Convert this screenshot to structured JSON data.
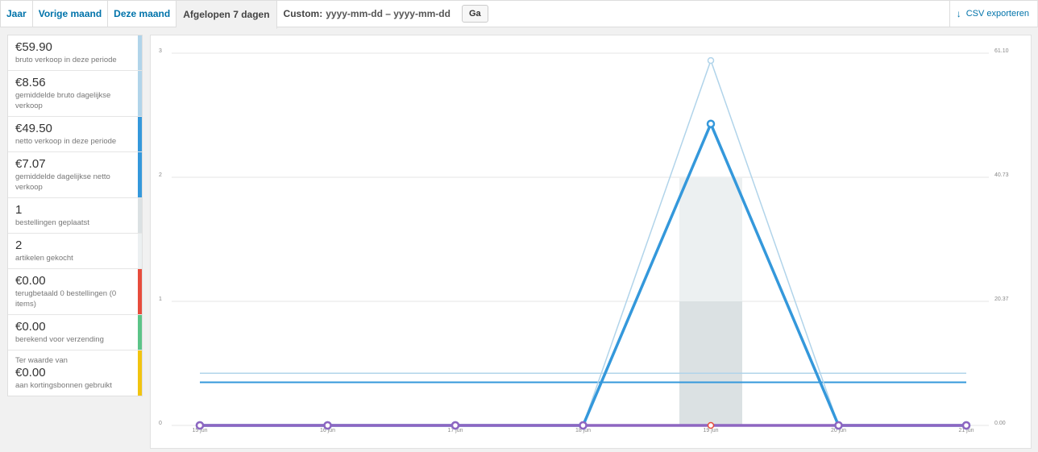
{
  "tabs": [
    {
      "label": "Jaar",
      "active": false
    },
    {
      "label": "Vorige maand",
      "active": false
    },
    {
      "label": "Deze maand",
      "active": false
    },
    {
      "label": "Afgelopen 7 dagen",
      "active": true
    }
  ],
  "custom": {
    "label": "Custom:",
    "range": "yyyy-mm-dd – yyyy-mm-dd",
    "go_label": "Ga"
  },
  "export": {
    "label": "CSV exporteren",
    "icon": "download-arrow-icon"
  },
  "legend": [
    {
      "amount": "€59.90",
      "desc": "bruto verkoop in deze periode",
      "color": "#b1d4ea"
    },
    {
      "amount": "€8.56",
      "desc": "gemiddelde bruto dagelijkse verkoop",
      "color": "#b1d4ea"
    },
    {
      "amount": "€49.50",
      "desc": "netto verkoop in deze periode",
      "color": "#3498db"
    },
    {
      "amount": "€7.07",
      "desc": "gemiddelde dagelijkse netto verkoop",
      "color": "#3498db"
    },
    {
      "amount": "1",
      "desc": "bestellingen geplaatst",
      "color": "#dbe1e3"
    },
    {
      "amount": "2",
      "desc": "artikelen gekocht",
      "color": "#ecf0f1"
    },
    {
      "amount": "€0.00",
      "desc": "terugbetaald 0 bestellingen (0 items)",
      "color": "#e74c3c"
    },
    {
      "amount": "€0.00",
      "desc": "berekend voor verzending",
      "color": "#5cc488"
    },
    {
      "prefix": "Ter waarde van",
      "amount": "€0.00",
      "desc": "aan kortingsbonnen gebruikt",
      "color": "#f1c40f"
    }
  ],
  "chart_data": {
    "type": "line",
    "categories": [
      "15 jun",
      "16 jun",
      "17 jun",
      "18 jun",
      "19 jun",
      "20 jun",
      "21 jun"
    ],
    "y_left": {
      "ticks": [
        "0",
        "1",
        "2",
        "3"
      ],
      "range": [
        0,
        3
      ]
    },
    "y_right": {
      "ticks": [
        "0.00",
        "20.37",
        "40.73",
        "61.10"
      ],
      "range": [
        0,
        61.1
      ]
    },
    "series": [
      {
        "key": "gross_sales",
        "axis": "right",
        "type": "line",
        "color": "#b1d4ea",
        "values": [
          0,
          0,
          0,
          0,
          59.9,
          0,
          0
        ]
      },
      {
        "key": "net_sales",
        "axis": "right",
        "type": "line",
        "color": "#3498db",
        "values": [
          0,
          0,
          0,
          0,
          49.5,
          0,
          0
        ]
      },
      {
        "key": "avg_gross",
        "axis": "right",
        "type": "hline",
        "color": "#b1d4ea",
        "value": 8.56
      },
      {
        "key": "avg_net",
        "axis": "right",
        "type": "hline",
        "color": "#3498db",
        "value": 7.07
      },
      {
        "key": "items_bought",
        "axis": "left",
        "type": "bar",
        "color": "#ecf0f1",
        "values": [
          0,
          0,
          0,
          0,
          2,
          0,
          0
        ]
      },
      {
        "key": "orders_placed",
        "axis": "left",
        "type": "bar",
        "color": "#dbe1e3",
        "values": [
          0,
          0,
          0,
          0,
          1,
          0,
          0
        ]
      },
      {
        "key": "refunds",
        "axis": "right",
        "type": "line",
        "color": "#e74c3c",
        "values": [
          0,
          0,
          0,
          0,
          0,
          0,
          0
        ]
      },
      {
        "key": "shipping",
        "axis": "right",
        "type": "line",
        "color": "#5cc488",
        "values": [
          0,
          0,
          0,
          0,
          0,
          0,
          0
        ]
      },
      {
        "key": "coupons",
        "axis": "right",
        "type": "line",
        "color": "#8e66c1",
        "values": [
          0,
          0,
          0,
          0,
          0,
          0,
          0
        ]
      }
    ]
  }
}
